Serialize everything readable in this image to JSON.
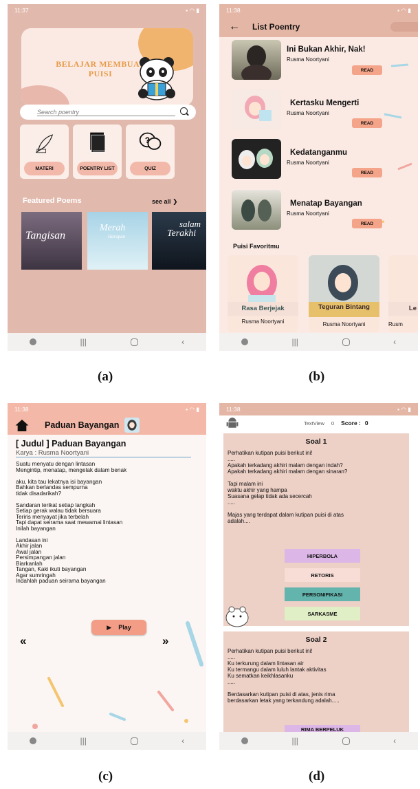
{
  "captions": {
    "a": "(a)",
    "b": "(b)",
    "c": "(c)",
    "d": "(d)"
  },
  "screen_a": {
    "status_time": "11:37",
    "banner_title_1": "BELAJAR MEMBUAT",
    "banner_title_2": "PUISI",
    "search_placeholder": "Search poentry",
    "menu": [
      "MATERI",
      "POENTRY LIST",
      "QUIZ"
    ],
    "featured_title": "Featured Poems",
    "see_all": "see all",
    "covers": [
      "Tangisan",
      "Merah",
      "Harapan",
      "salam",
      "Terakhi"
    ]
  },
  "screen_b": {
    "status_time": "11:38",
    "header_title": "List Poentry",
    "items": [
      {
        "title": "Ini Bukan Akhir, Nak!",
        "author": "Rusma Noortyani",
        "read": "READ"
      },
      {
        "title": "Kertasku Mengerti",
        "author": "Rusma Noortyani",
        "read": "READ"
      },
      {
        "title": "Kedatanganmu",
        "author": "Rusma Noortyani",
        "read": "READ"
      },
      {
        "title": "Menatap Bayangan",
        "author": "Rusma Noortyani",
        "read": "READ"
      }
    ],
    "favorites_title": "Puisi Favoritmu",
    "favorites": [
      {
        "title": "Rasa Berjejak",
        "author": "Rusma Noortyani"
      },
      {
        "title": "Teguran Bintang",
        "author": "Rusma Noortyani"
      },
      {
        "title": "Le",
        "author": "Rusm"
      }
    ]
  },
  "screen_c": {
    "status_time": "11:38",
    "header_title": "Paduan Bayangan",
    "judul": "[ Judul ] Paduan Bayangan",
    "karya": "Karya : Rusma Noortyani",
    "poem_text": "Suatu menyatu dengan lintasan\nMengintip, menatap, mengelak dalam benak\n\naku, kita tau lekatnya isi bayangan\nBahkan berlandas sempurna\ntidak disadarikah?\n\nSandaran terikat setiap langkah\nSetiap gerak walau tidak bersuara\nTeriris menyayat jika terbelah\nTapi dapat seirama saat mewarnai lintasan\nInilah bayangan\n\nLandasan ini\nAkhir jalan\nAwal jalan\nPersimpangan jalan\nBiarkanlah\nTangan, Kaki ikuti bayangan\nAgar sumringah\nIndahlah paduan seirama bayangan",
    "play": "Play",
    "prev": "«",
    "next": "»"
  },
  "screen_d": {
    "status_time": "11:38",
    "textview": "TextView",
    "count": "0",
    "score_label": "Score :",
    "score_value": "0",
    "q1_title": "Soal 1",
    "q1_text": "Perhatikan kutipan puisi berikut ini!\n.....\nApakah terkadang akhiri malam dengan indah?\nApakah terkadang akhiri malam dengan sinaran?\n\nTapi malam ini\nwaktu akhir yang hampa\nSuasana gelap tidak ada secercah\n.....\n\nMajas yang terdapat dalam kutipan puisi di atas\nadalah....",
    "options": [
      "HIPERBOLA",
      "RETORIS",
      "PERSONIFIKASI",
      "SARKASME"
    ],
    "q2_title": "Soal 2",
    "q2_text": "Perhatikan kutipan puisi berikut ini!\n.....\nKu terkurung dalam lintasan air\nKu termangu dalam luluh lantak aktivitas\nKu sematkan keikhlasanku\n.....\n\nBerdasarkan kutipan puisi di atas, jenis rima\nberdasarkan letak yang terkandung adalah.....",
    "q2_option1": "RIMA BERPELUK"
  }
}
